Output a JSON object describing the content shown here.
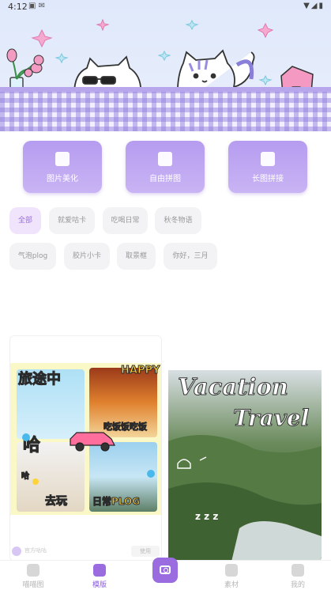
{
  "status_bar": {
    "time": "4:12",
    "left_icons": "▣ ✉",
    "right_icons": "▼◢▮"
  },
  "tools": [
    {
      "label": "图片美化",
      "icon": "magic-photo-icon"
    },
    {
      "label": "自由拼图",
      "icon": "free-collage-icon"
    },
    {
      "label": "长图拼接",
      "icon": "long-image-icon"
    }
  ],
  "tags": [
    {
      "label": "全部",
      "active": true
    },
    {
      "label": "就爱咕卡",
      "active": false
    },
    {
      "label": "吃喝日常",
      "active": false
    },
    {
      "label": "秋冬物语",
      "active": false
    },
    {
      "label": "气泡plog",
      "active": false
    },
    {
      "label": "胶片小卡",
      "active": false
    },
    {
      "label": "取景框",
      "active": false
    },
    {
      "label": "你好，三月",
      "active": false
    }
  ],
  "cards": {
    "left": {
      "stickers": [
        "旅途中",
        "HAPPY",
        "吃饭饭吃饭",
        "哈",
        "哈",
        "去玩",
        "日常PLOG"
      ],
      "footer_author": "官方咕咕",
      "footer_button": "使用"
    },
    "right": {
      "title_line1": "Vacation",
      "title_line2": "Travel",
      "doodle": "z z z"
    }
  },
  "bottom_nav": [
    {
      "label": "喵喵图",
      "icon": "cat-home-icon",
      "active": false
    },
    {
      "label": "模版",
      "icon": "template-icon",
      "active": true
    },
    {
      "label": "",
      "icon": "camera-icon",
      "active": false
    },
    {
      "label": "素材",
      "icon": "sticker-icon",
      "active": false
    },
    {
      "label": "我的",
      "icon": "profile-cat-icon",
      "active": false
    }
  ],
  "colors": {
    "accent": "#9b6ce0",
    "tool_gradient_top": "#b69cf0",
    "tag_bg": "#f3f3f6",
    "tag_active_bg": "#efe4fb"
  }
}
